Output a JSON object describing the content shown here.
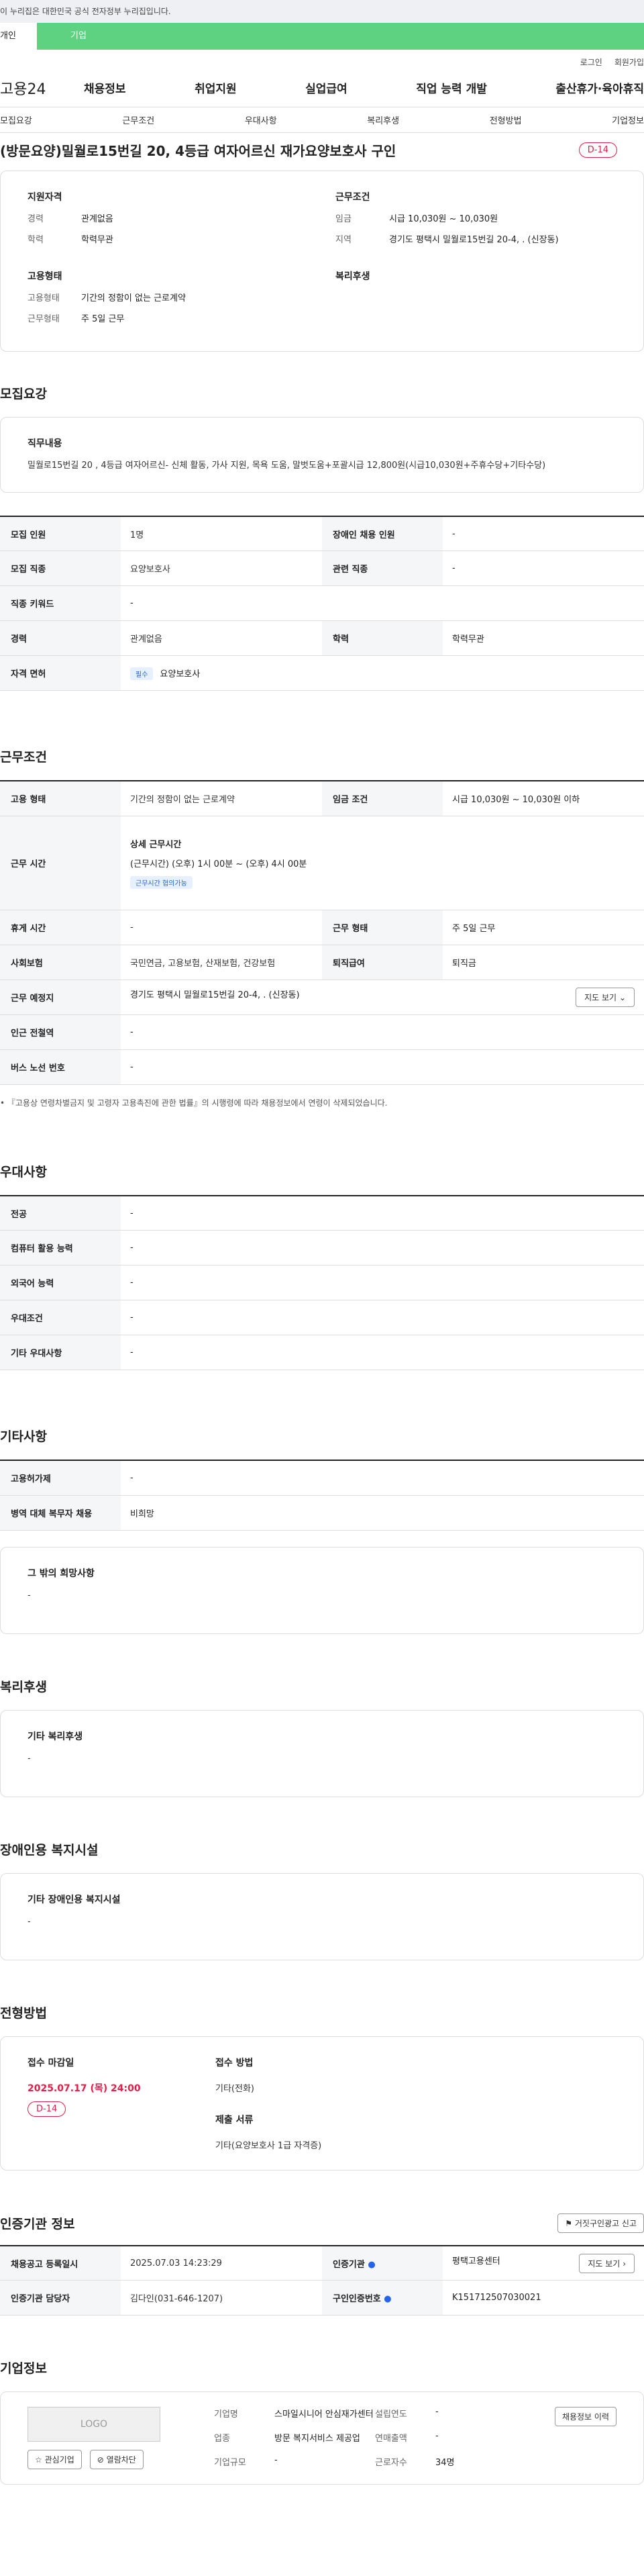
{
  "topbar": {
    "notice": "이 누리집은 대한민국 공식 전자정부 누리집입니다."
  },
  "tabs": {
    "tab1": "개인",
    "tab2": "기업"
  },
  "toplinks": {
    "login": "로그인",
    "join": "회원가입"
  },
  "gnb": {
    "logo": "고용24",
    "menu": [
      "채용정보",
      "취업지원",
      "실업급여",
      "직업 능력 개발",
      "출산휴가·육아휴직"
    ]
  },
  "subnav": [
    "모집요강",
    "근무조건",
    "우대사항",
    "복리후생",
    "전형방법",
    "기업정보"
  ],
  "job": {
    "title": "(방문요양)밀월로15번길 20, 4등급 여자어르신 재가요양보호사 구인",
    "dday": "D-14"
  },
  "summary": {
    "qual_title": "지원자격",
    "qual_rows": [
      {
        "k": "경력",
        "v": "관계없음"
      },
      {
        "k": "학력",
        "v": "학력무관"
      }
    ],
    "work_title": "근무조건",
    "work_rows": [
      {
        "k": "임금",
        "v": "시급 10,030원 ~ 10,030원"
      },
      {
        "k": "지역",
        "v": "경기도 평택시 밀월로15번길 20-4, . (신장동)"
      }
    ],
    "emp_title": "고용형태",
    "emp_rows": [
      {
        "k": "고용형태",
        "v": "기간의 정함이 없는 근로계약"
      },
      {
        "k": "근무형태",
        "v": "주 5일 근무"
      }
    ],
    "welfare_title": "복리후생"
  },
  "recruit": {
    "section": "모집요강",
    "duty_title": "직무내용",
    "duty_text": "밀월로15번길 20 , 4등급 여자어르신- 신체 활동,  가사 지원, 목욕 도움, 말벗도움+포괄시급 12,800원(시급10,030원+주휴수당+기타수당)",
    "rows": [
      {
        "k1": "모집 인원",
        "v1": "1명",
        "k2": "장애인 채용 인원",
        "v2": "-"
      },
      {
        "k1": "모집 직종",
        "v1": "요양보호사",
        "k2": "관련 직종",
        "v2": "-"
      },
      {
        "k1": "직종 키워드",
        "v1": "-"
      },
      {
        "k1": "경력",
        "v1": "관계없음",
        "k2": "학력",
        "v2": "학력무관"
      }
    ],
    "license_k": "자격 면허",
    "license_chip": "필수",
    "license_v": "요양보호사"
  },
  "conditions": {
    "section": "근무조건",
    "emp_k": "고용 형태",
    "emp_v": "기간의 정함이 없는 근로계약",
    "wage_k": "임금 조건",
    "wage_v": "시급 10,030원 ~ 10,030원 이하",
    "time_k": "근무 시간",
    "time_title": "상세 근무시간",
    "time_v": "(근무시간) (오후) 1시 00분 ~ (오후) 4시 00분",
    "time_chip": "근무시간 협의가능",
    "rest_k": "휴게 시간",
    "rest_v": "-",
    "form_k": "근무 형태",
    "form_v": "주 5일 근무",
    "ins_k": "사회보험",
    "ins_v": "국민연금, 고용보험, 산재보험, 건강보험",
    "ret_k": "퇴직급여",
    "ret_v": "퇴직금",
    "place_k": "근무 예정지",
    "place_v": "경기도 평택시 밀월로15번길 20-4, . (신장동)",
    "map_btn": "지도 보기",
    "station_k": "인근 전철역",
    "station_v": "-",
    "bus_k": "버스 노선 번호",
    "bus_v": "-",
    "note": "• 『고용상 연령차별금지 및 고령자 고용촉진에 관한 법률』의 시행령에 따라 채용정보에서 연령이 삭제되었습니다."
  },
  "pref": {
    "section": "우대사항",
    "rows": [
      {
        "k": "전공",
        "v": "-"
      },
      {
        "k": "컴퓨터 활용 능력",
        "v": "-"
      },
      {
        "k": "외국어 능력",
        "v": "-"
      },
      {
        "k": "우대조건",
        "v": "-"
      },
      {
        "k": "기타 우대사항",
        "v": "-"
      }
    ]
  },
  "etc": {
    "section": "기타사항",
    "rows": [
      {
        "k": "고용허가제",
        "v": "-"
      },
      {
        "k": "병역 대체 복무자 채용",
        "v": "비희망"
      }
    ],
    "hope_title": "그 밖의 희망사항",
    "hope_v": "-"
  },
  "welfare": {
    "section": "복리후생",
    "title": "기타 복리후생",
    "v": "-"
  },
  "disabled": {
    "section": "장애인용 복지시설",
    "title": "기타 장애인용 복지시설",
    "v": "-"
  },
  "selection": {
    "section": "전형방법",
    "deadline_label": "접수 마감일",
    "deadline": "2025.07.17 (목) 24:00",
    "dday": "D-14",
    "method_label": "접수 방법",
    "method_v": "기타(전화)",
    "docs_label": "제출 서류",
    "docs_v": "기타(요양보호사 1급 자격증)"
  },
  "cert": {
    "section": "인증기관 정보",
    "report_btn": "거짓구인광고 신고",
    "rows": [
      {
        "k1": "채용공고 등록일시",
        "v1": "2025.07.03 14:23:29",
        "k2": "인증기관",
        "v2": "평택고용센터"
      },
      {
        "k1": "인증기관 담당자",
        "v1": "김다인(031-646-1207)",
        "k2": "구인인증번호",
        "v2": "K151712507030021"
      }
    ],
    "map_btn": "지도 보기"
  },
  "company": {
    "section": "기업정보",
    "logo_text": "LOGO",
    "fav_btn": "관심기업",
    "block_btn": "열람차단",
    "name_k": "기업명",
    "name_v": "스마일시니어 안심재가센터",
    "ind_k": "업종",
    "ind_v": "방문 복지서비스 제공업",
    "size_k": "기업규모",
    "size_v": "-",
    "year_k": "설립연도",
    "year_v": "-",
    "sales_k": "연매출액",
    "sales_v": "-",
    "emp_k": "근로자수",
    "emp_v": "34명",
    "more_btn": "채용정보 이력"
  }
}
